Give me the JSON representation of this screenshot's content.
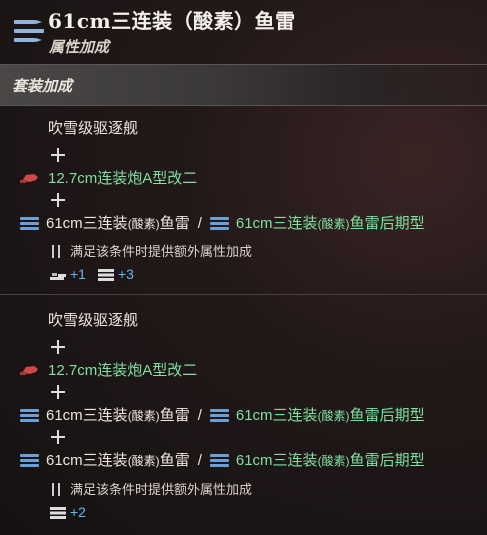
{
  "header": {
    "title": "61cm三连装（酸素）鱼雷",
    "subtitle": "属性加成",
    "icon": "torpedo-list-icon"
  },
  "section": {
    "title": "套装加成"
  },
  "groups": [
    {
      "ship": "吹雪级驱逐舰",
      "gun": "12.7cm连装炮A型改二",
      "torpedo_rows": [
        {
          "a_pre": "61cm三连装",
          "a_mid": "(酸素)",
          "a_post": "鱼雷",
          "sep": "/",
          "b_pre": "61cm三连装",
          "b_mid": "(酸素)",
          "b_post": "鱼雷后期型"
        }
      ],
      "note": "满足该条件时提供额外属性加成",
      "bonuses": [
        {
          "icon": "firepower-icon",
          "value": "+1"
        },
        {
          "icon": "torpedo-stat-icon",
          "value": "+3"
        }
      ]
    },
    {
      "ship": "吹雪级驱逐舰",
      "gun": "12.7cm连装炮A型改二",
      "torpedo_rows": [
        {
          "a_pre": "61cm三连装",
          "a_mid": "(酸素)",
          "a_post": "鱼雷",
          "sep": "/",
          "b_pre": "61cm三连装",
          "b_mid": "(酸素)",
          "b_post": "鱼雷后期型"
        },
        {
          "a_pre": "61cm三连装",
          "a_mid": "(酸素)",
          "a_post": "鱼雷",
          "sep": "/",
          "b_pre": "61cm三连装",
          "b_mid": "(酸素)",
          "b_post": "鱼雷后期型"
        }
      ],
      "note": "满足该条件时提供额外属性加成",
      "bonuses": [
        {
          "icon": "torpedo-stat-icon",
          "value": "+2"
        }
      ]
    }
  ],
  "colors": {
    "green": "#7fe0a0",
    "blue": "#5ab8f0",
    "white": "#ece6de",
    "gun_red": "#d04848",
    "torpedo_blue": "#6a9fd8"
  }
}
